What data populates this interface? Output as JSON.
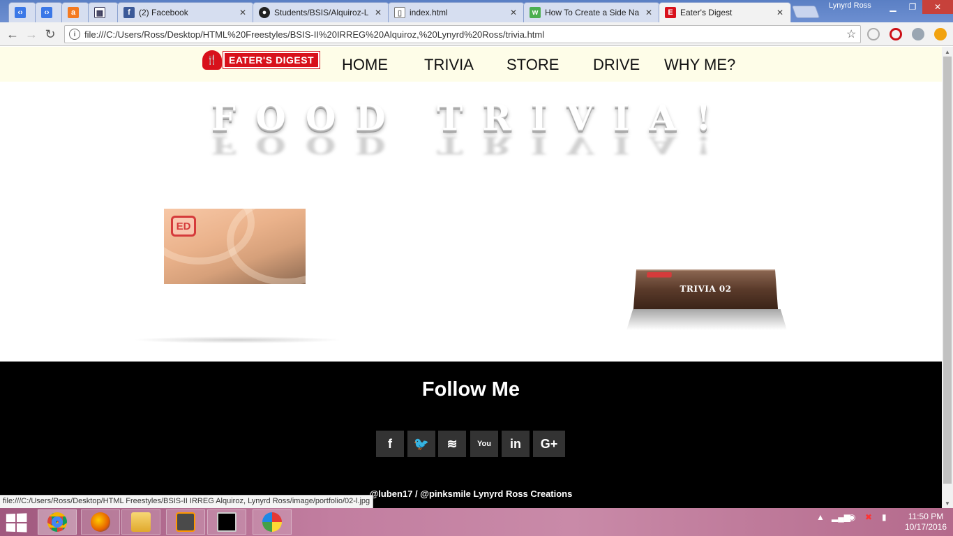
{
  "browser": {
    "tabs": [
      {
        "label": "",
        "icon": "code-icon"
      },
      {
        "label": "",
        "icon": "code-icon"
      },
      {
        "label": "",
        "icon": "avast-icon"
      },
      {
        "label": "",
        "icon": "grid-icon"
      },
      {
        "label": "(2) Facebook",
        "icon": "facebook-icon"
      },
      {
        "label": "Students/BSIS/Alquiroz-L",
        "icon": "github-icon"
      },
      {
        "label": "index.html",
        "icon": "file-icon"
      },
      {
        "label": "How To Create a Side Na",
        "icon": "w3schools-icon"
      },
      {
        "label": "Eater's Digest",
        "icon": "eaters-digest-icon"
      }
    ],
    "profile_name": "Lynyrd Ross",
    "url": "file:///C:/Users/Ross/Desktop/HTML%20Freestyles/BSIS-II%20IRREG%20Alquiroz,%20Lynyrd%20Ross/trivia.html",
    "status_url": "file:///C:/Users/Ross/Desktop/HTML Freestyles/BSIS-II IRREG Alquiroz, Lynyrd Ross/image/portfolio/02-l.jpg"
  },
  "site": {
    "logo_text": "EATER'S DIGEST",
    "nav": [
      "HOME",
      "TRIVIA",
      "STORE",
      "DRIVE",
      "WHY ME?"
    ],
    "page_title": "FOOD TRIVIA!",
    "card1_badge": "ED",
    "card2_label": "TRIVIA 02",
    "footer_heading": "Follow Me",
    "social": [
      {
        "icon": "facebook-icon",
        "glyph": "f"
      },
      {
        "icon": "twitter-icon",
        "glyph": "🐦"
      },
      {
        "icon": "rss-icon",
        "glyph": "≋"
      },
      {
        "icon": "youtube-icon",
        "glyph": "You"
      },
      {
        "icon": "linkedin-icon",
        "glyph": "in"
      },
      {
        "icon": "google-plus-icon",
        "glyph": "G+"
      }
    ],
    "copyright": "@luben17 / @pinksmile Lynyrd Ross Creations"
  },
  "taskbar": {
    "apps": [
      "chrome-icon",
      "firefox-icon",
      "file-explorer-icon",
      "sublime-text-icon",
      "command-prompt-icon",
      "paint-icon"
    ],
    "time": "11:50 PM",
    "date": "10/17/2016"
  },
  "colors": {
    "brand_red": "#d8111b",
    "nav_bg": "#fefde8",
    "footer_bg": "#000000"
  }
}
